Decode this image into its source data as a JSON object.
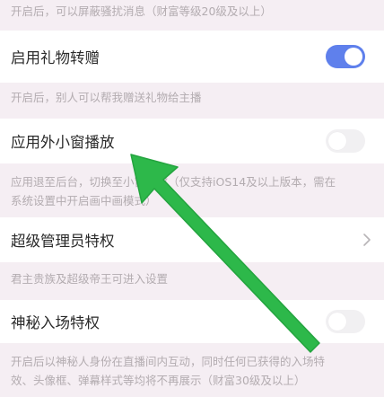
{
  "settings": {
    "hint_top": "开启后，可以屏蔽骚扰消息（财富等级20级及以上）",
    "gift_transfer": {
      "label": "启用礼物转赠",
      "enabled": true,
      "hint": "开启后，别人可以帮我赠送礼物给主播"
    },
    "pip": {
      "label": "应用外小窗播放",
      "enabled": false,
      "hint_line1": "应用退至后台，切换至小窗播放（仅支持iOS14及以上版本，需在",
      "hint_line2": "系统设置中开启画中画模式）"
    },
    "super_admin": {
      "label": "超级管理员特权",
      "hint": "君主贵族及超级帝王可进入设置"
    },
    "mystery_entry": {
      "label": "神秘入场特权",
      "enabled": false,
      "hint_line1": "开启后以神秘人身份在直播间内互动，同时任何已获得的入场特",
      "hint_line2": "效、头像框、弹幕样式等均将不再展示（财富30级及以上）"
    }
  },
  "colors": {
    "toggle_on": "#5f80ec",
    "toggle_off": "#f1f0f2",
    "annotation_arrow": "#2db84a"
  },
  "icons": {
    "chevron": "chevron-right-icon",
    "annotation": "green-arrow-icon"
  }
}
